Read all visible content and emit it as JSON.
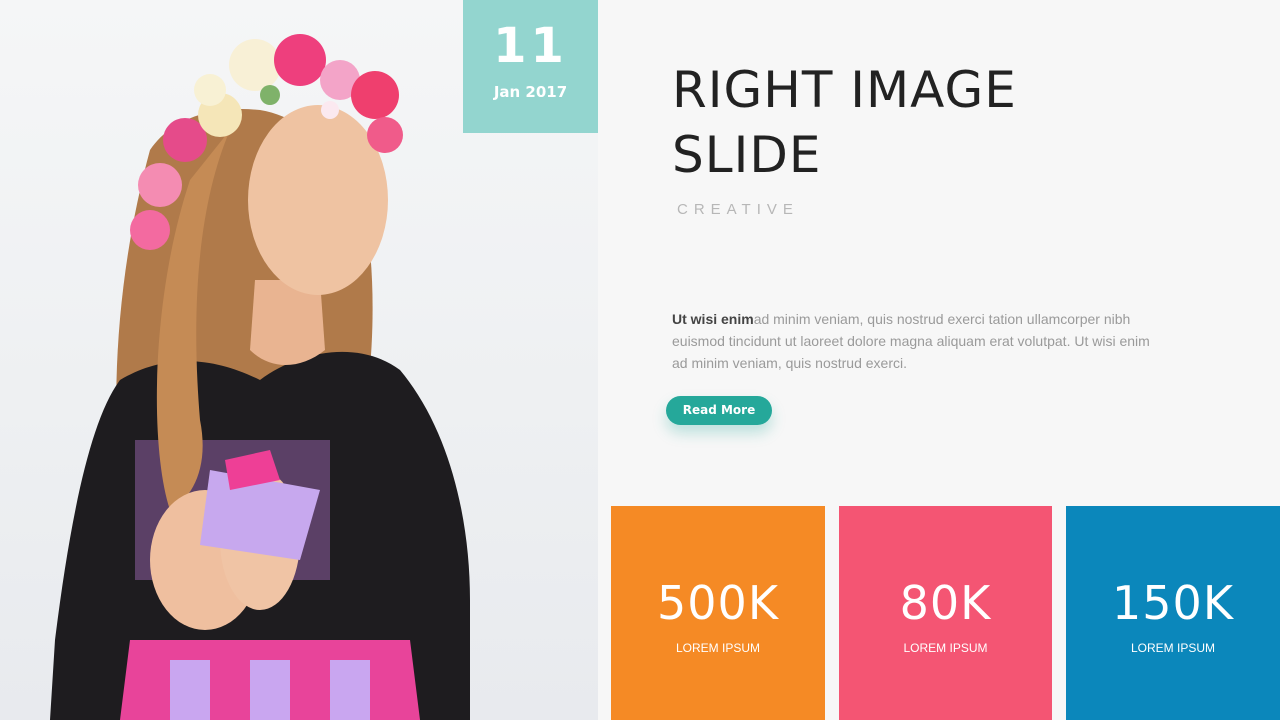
{
  "date": {
    "day": "11",
    "month_year": "Jan 2017"
  },
  "title": {
    "line1": "RIGHT IMAGE",
    "line2": "SLIDE"
  },
  "subtitle": "CREATIVE",
  "body": {
    "lead": "Ut wisi enim",
    "text": "ad minim veniam, quis nostrud exerci tation ullamcorper nibh euismod tincidunt ut laoreet dolore magna aliquam erat volutpat. Ut wisi enim ad minim veniam, quis nostrud exerci."
  },
  "read_more_label": "Read More",
  "stats": [
    {
      "value": "500K",
      "label": "LOREM IPSUM",
      "color": "#f58a25"
    },
    {
      "value": "80K",
      "label": "LOREM IPSUM",
      "color": "#f45573"
    },
    {
      "value": "150K",
      "label": "LOREM IPSUM",
      "color": "#0b87bb"
    }
  ],
  "colors": {
    "date_badge": "#93d5cf",
    "button": "#25a89a",
    "background": "#f7f7f7"
  },
  "photo_icon": "woman-with-flower-crown-photo"
}
